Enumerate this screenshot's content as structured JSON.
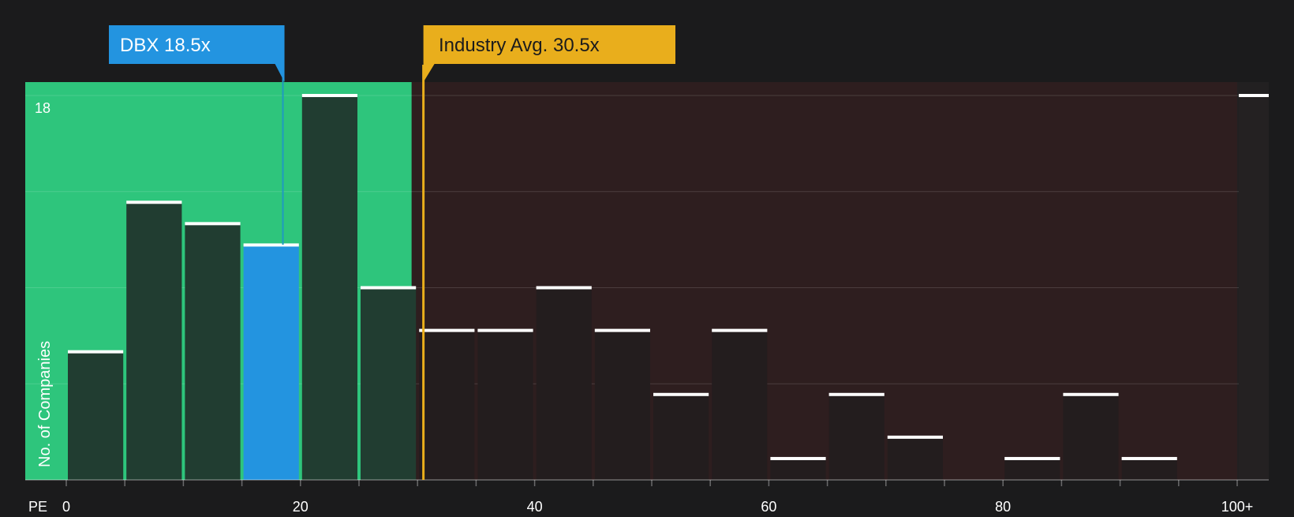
{
  "colors": {
    "background": "#1b1b1c",
    "fair_zone": "#2ec57c",
    "overvalued_zone": "#2e1e1f",
    "bar_dark": "#213d31",
    "bar_highlight": "#2394e0",
    "bar_cap": "#ffffff",
    "dbx_callout": "#2394e0",
    "industry_callout": "#e9ae1c",
    "industry_text": "#1b1b1c",
    "axis_text": "#ffffff"
  },
  "callouts": {
    "company": {
      "label": "DBX 18.5x",
      "value": 18.5
    },
    "industry": {
      "label": "Industry Avg. 30.5x",
      "value": 30.5
    }
  },
  "chart_data": {
    "type": "bar",
    "title": "",
    "xlabel": "PE",
    "ylabel": "No. of Companies",
    "ylim": [
      0,
      18
    ],
    "y_ticks": [
      "18"
    ],
    "x_ticks": [
      {
        "value": 0,
        "label": "0"
      },
      {
        "value": 20,
        "label": "20"
      },
      {
        "value": 40,
        "label": "40"
      },
      {
        "value": 60,
        "label": "60"
      },
      {
        "value": 80,
        "label": "80"
      },
      {
        "value": 100,
        "label": "100+"
      }
    ],
    "bin_width": 5,
    "fair_value_upper": 29.5,
    "highlight_bin_start": 15,
    "bins": [
      {
        "start": 0,
        "value": 6
      },
      {
        "start": 5,
        "value": 13
      },
      {
        "start": 10,
        "value": 12
      },
      {
        "start": 15,
        "value": 11
      },
      {
        "start": 20,
        "value": 18
      },
      {
        "start": 25,
        "value": 9
      },
      {
        "start": 30,
        "value": 7
      },
      {
        "start": 35,
        "value": 7
      },
      {
        "start": 40,
        "value": 9
      },
      {
        "start": 45,
        "value": 7
      },
      {
        "start": 50,
        "value": 4
      },
      {
        "start": 55,
        "value": 7
      },
      {
        "start": 60,
        "value": 1
      },
      {
        "start": 65,
        "value": 4
      },
      {
        "start": 70,
        "value": 2
      },
      {
        "start": 75,
        "value": 0
      },
      {
        "start": 80,
        "value": 1
      },
      {
        "start": 85,
        "value": 4
      },
      {
        "start": 90,
        "value": 1
      },
      {
        "start": 95,
        "value": 0
      },
      {
        "start": 100,
        "value": 18
      }
    ]
  }
}
